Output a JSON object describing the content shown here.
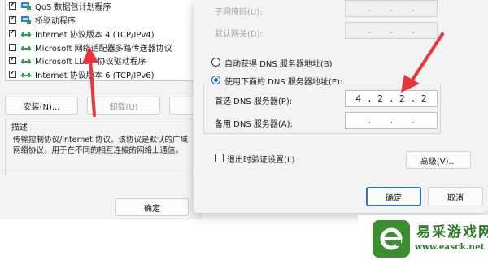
{
  "left_dialog": {
    "components": [
      {
        "label": "QoS 数据包计划程序",
        "checked": true,
        "icon": "qos-scheduler-icon"
      },
      {
        "label": "桥驱动程序",
        "checked": true,
        "icon": "bridge-driver-icon"
      },
      {
        "label": "Internet 协议版本 4 (TCP/IPv4)",
        "checked": true,
        "icon": "network-protocol-icon"
      },
      {
        "label": "Microsoft 网络适配器多路传送器协议",
        "checked": false,
        "icon": "network-protocol-icon"
      },
      {
        "label": "Microsoft LLDP 协议驱动程序",
        "checked": true,
        "icon": "network-protocol-icon"
      },
      {
        "label": "Internet 协议版本 6 (TCP/IPv6)",
        "checked": true,
        "icon": "network-protocol-icon"
      }
    ],
    "install_label": "安装(N)...",
    "uninstall_label": "卸载(U)",
    "description_heading": "描述",
    "description_text": "传输控制协议/Internet 协议。该协议是默认的广域网络协议，用于在不同的相互连接的网络上通信。",
    "ok_label": "确定"
  },
  "right_dialog": {
    "subnet_label": "子网掩码(U):",
    "gateway_label": "默认网关(D):",
    "auto_dns_label": "自动获得 DNS 服务器地址(B)",
    "manual_dns_label": "使用下面的 DNS 服务器地址(E):",
    "preferred_dns_label": "首选 DNS 服务器(P):",
    "preferred_dns": [
      "4",
      "2",
      "2",
      "2"
    ],
    "alternate_dns_label": "备用 DNS 服务器(A):",
    "alternate_dns": [
      "",
      "",
      "",
      ""
    ],
    "validate_label": "退出时验证设置(L)",
    "validate_checked": false,
    "advanced_label": "高级(V)...",
    "ok_label": "确定",
    "cancel_label": "取消"
  },
  "annotation": {
    "arrow_color": "#e8343a"
  },
  "watermark": {
    "title": "易采游戏网",
    "url": "www.easck.net",
    "brand_color": "#2d7d26"
  }
}
